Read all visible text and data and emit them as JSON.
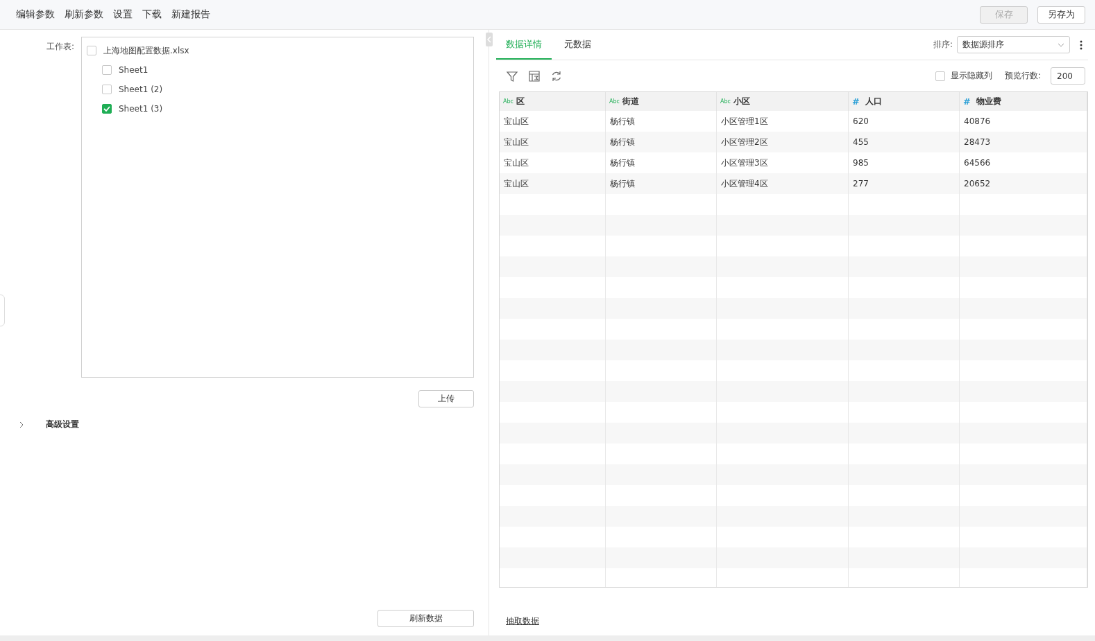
{
  "toolbar": {
    "menu": [
      "编辑参数",
      "刷新参数",
      "设置",
      "下载",
      "新建报告"
    ],
    "buttons": [
      {
        "label": "保存",
        "disabled": true
      },
      {
        "label": "另存为",
        "disabled": false
      }
    ]
  },
  "source_panel": {
    "worksheet_label": "工作表:",
    "tree": [
      {
        "label": "上海地图配置数据.xlsx",
        "checked": false,
        "children": [
          {
            "label": "Sheet1",
            "checked": false
          },
          {
            "label": "Sheet1 (2)",
            "checked": false
          },
          {
            "label": "Sheet1 (3)",
            "checked": true
          }
        ]
      }
    ],
    "upload_button": "上传",
    "advanced": {
      "label": "高级设置",
      "expanded": false
    },
    "refresh_button": "刷新数据"
  },
  "data_panel": {
    "tabs": [
      {
        "label": "数据详情",
        "selected": true
      },
      {
        "label": "元数据",
        "selected": false
      }
    ],
    "sort": {
      "label": "排序:",
      "value": "数据源排序"
    },
    "show_hidden": {
      "label": "显示隐藏列",
      "checked": false
    },
    "preview_rows": {
      "label": "预览行数:",
      "value": "200"
    },
    "table": {
      "columns": [
        {
          "name": "区",
          "kind": "text",
          "type_mark": "Abc"
        },
        {
          "name": "街道",
          "kind": "text",
          "type_mark": "Abc"
        },
        {
          "name": "小区",
          "kind": "text",
          "type_mark": "Abc"
        },
        {
          "name": "人口",
          "kind": "number",
          "type_mark": "#"
        },
        {
          "name": "物业费",
          "kind": "number",
          "type_mark": "#"
        }
      ],
      "rows": [
        [
          "宝山区",
          "杨行镇",
          "小区管理1区",
          "620",
          "40876"
        ],
        [
          "宝山区",
          "杨行镇",
          "小区管理2区",
          "455",
          "28473"
        ],
        [
          "宝山区",
          "杨行镇",
          "小区管理3区",
          "985",
          "64566"
        ],
        [
          "宝山区",
          "杨行镇",
          "小区管理4区",
          "277",
          "20652"
        ]
      ]
    },
    "extract_link": "抽取数据"
  }
}
